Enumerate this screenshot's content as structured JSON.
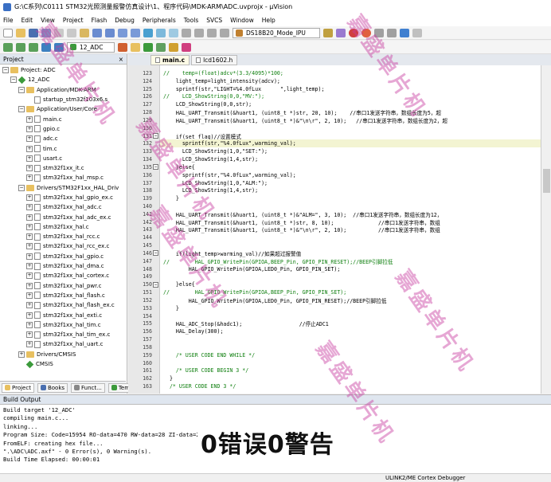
{
  "window": {
    "title": "G:\\C系列\\C0111 STM32光照测量报警仿真设计\\1、程序代码\\MDK-ARM\\ADC.uvprojx - µVision"
  },
  "menu": [
    "File",
    "Edit",
    "View",
    "Project",
    "Flash",
    "Debug",
    "Peripherals",
    "Tools",
    "SVCS",
    "Window",
    "Help"
  ],
  "toolbar": {
    "target_combo": "DS18B20_Mode_IPU",
    "build_target_combo": "12_ADC"
  },
  "project_panel": {
    "title": "Project",
    "close_glyph": "×",
    "rows": [
      {
        "indent": 0,
        "kind": "root",
        "exp": "−",
        "label": "Project: ADC"
      },
      {
        "indent": 1,
        "kind": "target",
        "exp": "−",
        "label": "12_ADC"
      },
      {
        "indent": 2,
        "kind": "folder",
        "exp": "−",
        "label": "Application/MDK-ARM"
      },
      {
        "indent": 3,
        "kind": "file",
        "exp": "",
        "label": "startup_stm32f103x6.s"
      },
      {
        "indent": 2,
        "kind": "folder",
        "exp": "−",
        "label": "Application/User/Core"
      },
      {
        "indent": 3,
        "kind": "file",
        "exp": "+",
        "label": "main.c"
      },
      {
        "indent": 3,
        "kind": "file",
        "exp": "+",
        "label": "gpio.c"
      },
      {
        "indent": 3,
        "kind": "file",
        "exp": "+",
        "label": "adc.c"
      },
      {
        "indent": 3,
        "kind": "file",
        "exp": "+",
        "label": "tim.c"
      },
      {
        "indent": 3,
        "kind": "file",
        "exp": "+",
        "label": "usart.c"
      },
      {
        "indent": 3,
        "kind": "file",
        "exp": "+",
        "label": "stm32f1xx_it.c"
      },
      {
        "indent": 3,
        "kind": "file",
        "exp": "+",
        "label": "stm32f1xx_hal_msp.c"
      },
      {
        "indent": 2,
        "kind": "folder",
        "exp": "−",
        "label": "Drivers/STM32F1xx_HAL_Driv"
      },
      {
        "indent": 3,
        "kind": "file",
        "exp": "+",
        "label": "stm32f1xx_hal_gpio_ex.c"
      },
      {
        "indent": 3,
        "kind": "file",
        "exp": "+",
        "label": "stm32f1xx_hal_adc.c"
      },
      {
        "indent": 3,
        "kind": "file",
        "exp": "+",
        "label": "stm32f1xx_hal_adc_ex.c"
      },
      {
        "indent": 3,
        "kind": "file",
        "exp": "+",
        "label": "stm32f1xx_hal.c"
      },
      {
        "indent": 3,
        "kind": "file",
        "exp": "+",
        "label": "stm32f1xx_hal_rcc.c"
      },
      {
        "indent": 3,
        "kind": "file",
        "exp": "+",
        "label": "stm32f1xx_hal_rcc_ex.c"
      },
      {
        "indent": 3,
        "kind": "file",
        "exp": "+",
        "label": "stm32f1xx_hal_gpio.c"
      },
      {
        "indent": 3,
        "kind": "file",
        "exp": "+",
        "label": "stm32f1xx_hal_dma.c"
      },
      {
        "indent": 3,
        "kind": "file",
        "exp": "+",
        "label": "stm32f1xx_hal_cortex.c"
      },
      {
        "indent": 3,
        "kind": "file",
        "exp": "+",
        "label": "stm32f1xx_hal_pwr.c"
      },
      {
        "indent": 3,
        "kind": "file",
        "exp": "+",
        "label": "stm32f1xx_hal_flash.c"
      },
      {
        "indent": 3,
        "kind": "file",
        "exp": "+",
        "label": "stm32f1xx_hal_flash_ex.c"
      },
      {
        "indent": 3,
        "kind": "file",
        "exp": "+",
        "label": "stm32f1xx_hal_exti.c"
      },
      {
        "indent": 3,
        "kind": "file",
        "exp": "+",
        "label": "stm32f1xx_hal_tim.c"
      },
      {
        "indent": 3,
        "kind": "file",
        "exp": "+",
        "label": "stm32f1xx_hal_tim_ex.c"
      },
      {
        "indent": 3,
        "kind": "file",
        "exp": "+",
        "label": "stm32f1xx_hal_uart.c"
      },
      {
        "indent": 2,
        "kind": "folder",
        "exp": "+",
        "label": "Drivers/CMSIS"
      },
      {
        "indent": 2,
        "kind": "cmsis",
        "exp": "",
        "label": "CMSIS"
      }
    ],
    "tabs": [
      "Project",
      "Books",
      "Funct...",
      "Templ..."
    ]
  },
  "editor": {
    "tabs": [
      {
        "label": "main.c",
        "active": true
      },
      {
        "label": "lcd1602.h",
        "active": false
      }
    ],
    "lines": [
      {
        "n": "123",
        "fold": "",
        "type": "comment",
        "text": "//    temp=(float)adcv*(3.3/4095)*100;"
      },
      {
        "n": "124",
        "fold": "",
        "type": "code",
        "text": "    light_temp=light_intensity(adcv);"
      },
      {
        "n": "125",
        "fold": "",
        "type": "code",
        "text": "    sprintf(str,\"LIGHT=%4.0fLux      \",light_temp);"
      },
      {
        "n": "126",
        "fold": "",
        "type": "comment",
        "text": "//    LCD_ShowString(0,0,\"MV:\");"
      },
      {
        "n": "127",
        "fold": "",
        "type": "code",
        "text": "    LCD_ShowString(0,0,str);"
      },
      {
        "n": "128",
        "fold": "",
        "type": "code",
        "text": "    HAL_UART_Transmit(&huart1, (uint8_t *)str, 20, 10);    //串口1发送字符串，数组长度为5，超"
      },
      {
        "n": "129",
        "fold": "",
        "type": "code",
        "text": "    HAL_UART_Transmit(&huart1, (uint8_t *)&\"\\n\\r\", 2, 10);   //串口1发送字符串，数组长度为2，超"
      },
      {
        "n": "130",
        "fold": "",
        "type": "code",
        "text": ""
      },
      {
        "n": "131",
        "fold": "−",
        "type": "code",
        "text": "    if(set_flag)//设置模式"
      },
      {
        "n": "132",
        "fold": "",
        "type": "hl",
        "text": "      sprintf(str,\"%4.0fLux\",warming_val);"
      },
      {
        "n": "133",
        "fold": "",
        "type": "code",
        "text": "      LCD_ShowString(1,0,\"SET:\");"
      },
      {
        "n": "134",
        "fold": "",
        "type": "code",
        "text": "      LCD_ShowString(1,4,str);"
      },
      {
        "n": "135",
        "fold": "−",
        "type": "code",
        "text": "    }else{"
      },
      {
        "n": "136",
        "fold": "",
        "type": "code",
        "text": "      sprintf(str,\"%4.0fLux\",warming_val);"
      },
      {
        "n": "137",
        "fold": "",
        "type": "code",
        "text": "      LCD_ShowString(1,0,\"ALM:\");"
      },
      {
        "n": "138",
        "fold": "",
        "type": "code",
        "text": "      LCD_ShowString(1,4,str);"
      },
      {
        "n": "139",
        "fold": "",
        "type": "code",
        "text": "    }"
      },
      {
        "n": "140",
        "fold": "",
        "type": "code",
        "text": ""
      },
      {
        "n": "141",
        "fold": "",
        "type": "code",
        "text": "    HAL_UART_Transmit(&huart1, (uint8_t *)&\"ALM=\", 3, 10);  //串口1发送字符串，数组长度为12，"
      },
      {
        "n": "142",
        "fold": "",
        "type": "code",
        "text": "    HAL_UART_Transmit(&huart1, (uint8_t *)str, 8, 10);              //串口1发送字符串，数组"
      },
      {
        "n": "143",
        "fold": "",
        "type": "code",
        "text": "    HAL_UART_Transmit(&huart1, (uint8_t *)&\"\\n\\r\", 2, 10);          //串口1发送字符串，数组"
      },
      {
        "n": "144",
        "fold": "",
        "type": "code",
        "text": ""
      },
      {
        "n": "145",
        "fold": "",
        "type": "code",
        "text": ""
      },
      {
        "n": "146",
        "fold": "−",
        "type": "code",
        "text": "    if(light_temp>warming_val)//如果超过报警值"
      },
      {
        "n": "147",
        "fold": "",
        "type": "comment",
        "text": "//        HAL_GPIO_WritePin(GPIOA,BEEP_Pin, GPIO_PIN_RESET);//BEEP引脚拉低"
      },
      {
        "n": "148",
        "fold": "",
        "type": "code",
        "text": "        HAL_GPIO_WritePin(GPIOA,LED0_Pin, GPIO_PIN_SET);"
      },
      {
        "n": "149",
        "fold": "",
        "type": "code",
        "text": ""
      },
      {
        "n": "150",
        "fold": "−",
        "type": "code",
        "text": "    }else{"
      },
      {
        "n": "151",
        "fold": "",
        "type": "comment",
        "text": "//        HAL_GPIO_WritePin(GPIOA,BEEP_Pin, GPIO_PIN_SET);"
      },
      {
        "n": "152",
        "fold": "",
        "type": "code",
        "text": "        HAL_GPIO_WritePin(GPIOA,LED0_Pin, GPIO_PIN_RESET);//BEEP引脚拉低"
      },
      {
        "n": "153",
        "fold": "",
        "type": "code",
        "text": "    }"
      },
      {
        "n": "154",
        "fold": "",
        "type": "code",
        "text": ""
      },
      {
        "n": "155",
        "fold": "",
        "type": "code",
        "text": "    HAL_ADC_Stop(&hadc1);                  //停止ADC1"
      },
      {
        "n": "156",
        "fold": "",
        "type": "code",
        "text": "    HAL_Delay(300);"
      },
      {
        "n": "157",
        "fold": "",
        "type": "code",
        "text": ""
      },
      {
        "n": "158",
        "fold": "",
        "type": "code",
        "text": ""
      },
      {
        "n": "159",
        "fold": "",
        "type": "comment",
        "text": "    /* USER CODE END WHILE */"
      },
      {
        "n": "160",
        "fold": "",
        "type": "code",
        "text": ""
      },
      {
        "n": "161",
        "fold": "",
        "type": "comment",
        "text": "    /* USER CODE BEGIN 3 */"
      },
      {
        "n": "162",
        "fold": "",
        "type": "code",
        "text": "  }"
      },
      {
        "n": "163",
        "fold": "",
        "type": "comment",
        "text": "  /* USER CODE END 3 */"
      }
    ]
  },
  "build_output": {
    "title": "Build Output",
    "lines": [
      "Build target '12_ADC'",
      "compiling main.c...",
      "linking...",
      "Program Size: Code=15954 RO-data=470 RW-data=28 ZI-data=2156",
      "FromELF: creating hex file...",
      "\".\\ADC\\ADC.axf\" - 0 Error(s), 0 Warning(s).",
      "Build Time Elapsed:  00:00:01"
    ]
  },
  "overlay": {
    "big_text": "0错误0警告"
  },
  "watermarks": [
    "嘉盛单片机",
    "嘉盛单片机",
    "嘉盛单片机",
    "嘉盛单片机",
    "嘉盛单片机",
    "嘉盛单片机"
  ],
  "status": {
    "debugger": "ULINK2/ME Cortex Debugger"
  },
  "colors": {
    "comment": "#118011",
    "folder": "#e8c060",
    "watermark": "#c83ca0",
    "highlight_line": "#f3f4d2"
  }
}
